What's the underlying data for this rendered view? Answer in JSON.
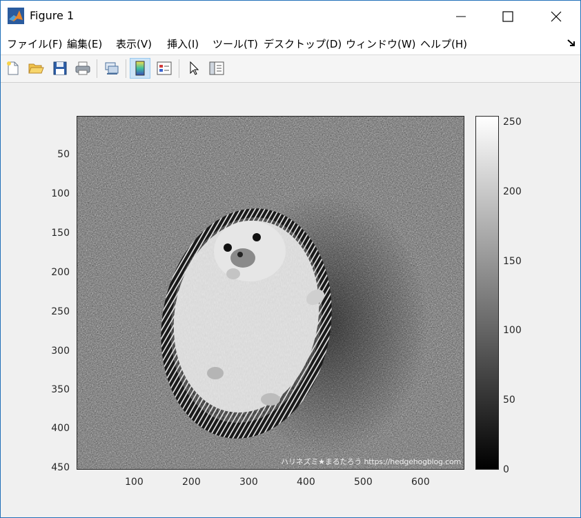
{
  "window": {
    "title": "Figure 1",
    "minimize_glyph": "—",
    "maximize_glyph": "☐",
    "close_glyph": "✕"
  },
  "menu": {
    "items": [
      "ファイル(F)",
      "編集(E)",
      "表示(V)",
      "挿入(I)",
      "ツール(T)",
      "デスクトップ(D)",
      "ウィンドウ(W)",
      "ヘルプ(H)"
    ]
  },
  "toolbar": {
    "buttons": [
      {
        "icon": "new-figure-icon"
      },
      {
        "icon": "open-folder-icon"
      },
      {
        "icon": "save-icon"
      },
      {
        "icon": "print-icon"
      },
      {
        "icon": "link-plot-icon"
      },
      {
        "icon": "insert-colorbar-icon",
        "active": true
      },
      {
        "icon": "insert-legend-icon"
      },
      {
        "icon": "edit-plot-cursor-icon"
      },
      {
        "icon": "property-inspector-icon"
      }
    ]
  },
  "axes": {
    "y_ticks": [
      "50",
      "100",
      "150",
      "200",
      "250",
      "300",
      "350",
      "400",
      "450"
    ],
    "x_ticks": [
      "100",
      "200",
      "300",
      "400",
      "500",
      "600"
    ],
    "image_caption": "ハリネズミ★まるたろう https://hedgehogblog.com"
  },
  "colorbar": {
    "ticks": [
      "250",
      "200",
      "150",
      "100",
      "50",
      "0"
    ]
  },
  "chart_data": {
    "type": "heatmap",
    "colormap": "gray",
    "x_range": [
      0.5,
      675.5
    ],
    "y_range": [
      0.5,
      450.5
    ],
    "y_direction": "reverse",
    "x_ticks": [
      100,
      200,
      300,
      400,
      500,
      600
    ],
    "y_ticks": [
      50,
      100,
      150,
      200,
      250,
      300,
      350,
      400,
      450
    ],
    "colorbar_range": [
      0,
      255
    ],
    "colorbar_ticks": [
      0,
      50,
      100,
      150,
      200,
      250
    ]
  }
}
